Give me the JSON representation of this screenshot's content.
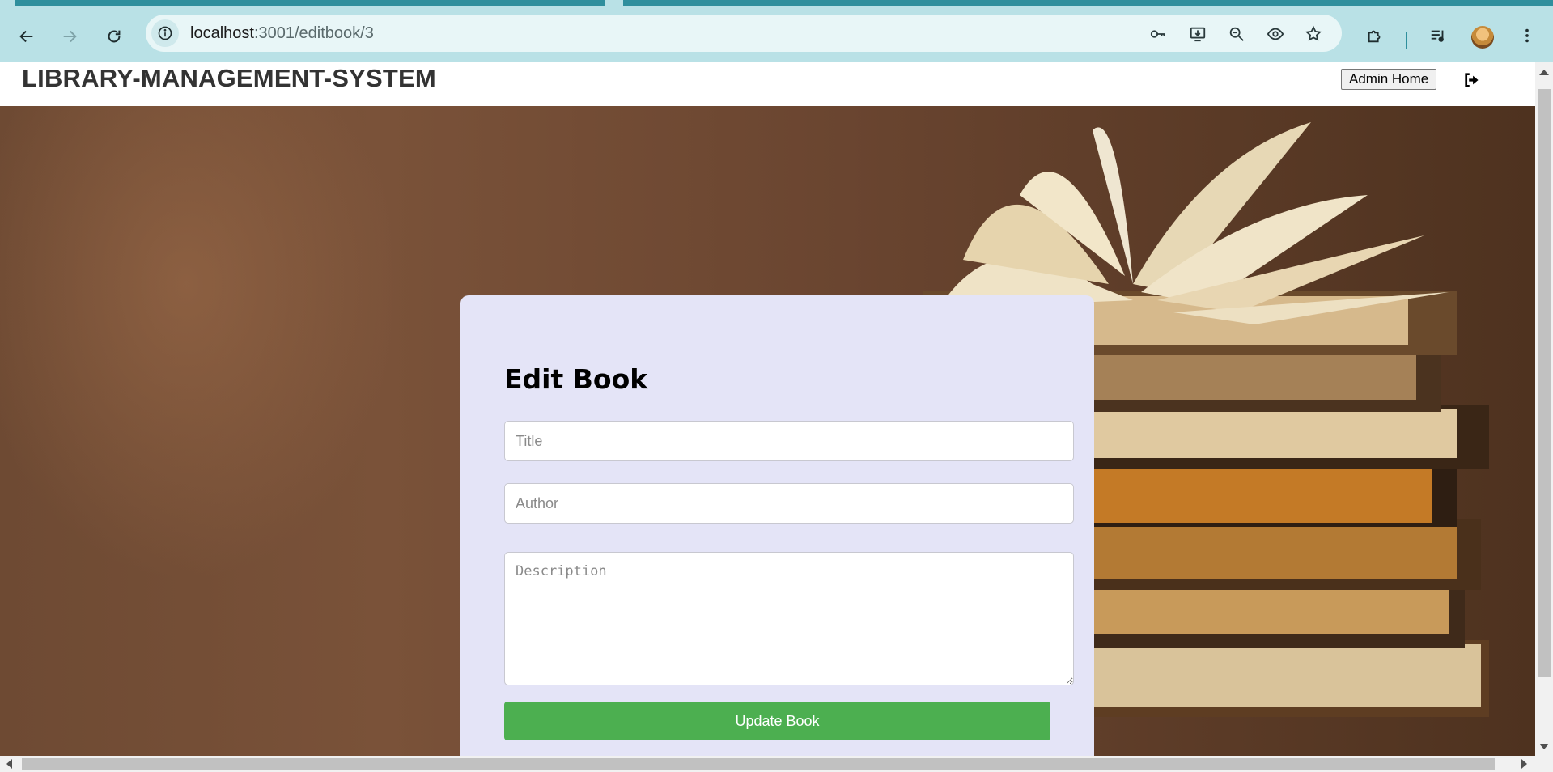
{
  "browser": {
    "url_host": "localhost",
    "url_path": ":3001/editbook/3"
  },
  "app": {
    "brand": "LIBRARY-MANAGEMENT-SYSTEM",
    "admin_home_label": "Admin Home"
  },
  "form": {
    "heading": "Edit Book",
    "title_placeholder": "Title",
    "author_placeholder": "Author",
    "description_placeholder": "Description",
    "submit_label": "Update Book",
    "title_value": "",
    "author_value": "",
    "description_value": ""
  },
  "colors": {
    "browser_chrome": "#b9e1e6",
    "card_background": "#e4e4f7",
    "submit_button": "#4caf50"
  },
  "icons": {
    "back": "back-arrow-icon",
    "forward": "forward-arrow-icon",
    "reload": "reload-icon",
    "site_info": "info-icon",
    "password": "key-icon",
    "install": "install-icon",
    "zoom": "zoom-out-icon",
    "reader": "eye-icon",
    "bookmark": "star-icon",
    "extensions": "puzzle-icon",
    "media": "media-control-icon",
    "menu": "kebab-menu-icon",
    "logout": "sign-out-icon"
  }
}
